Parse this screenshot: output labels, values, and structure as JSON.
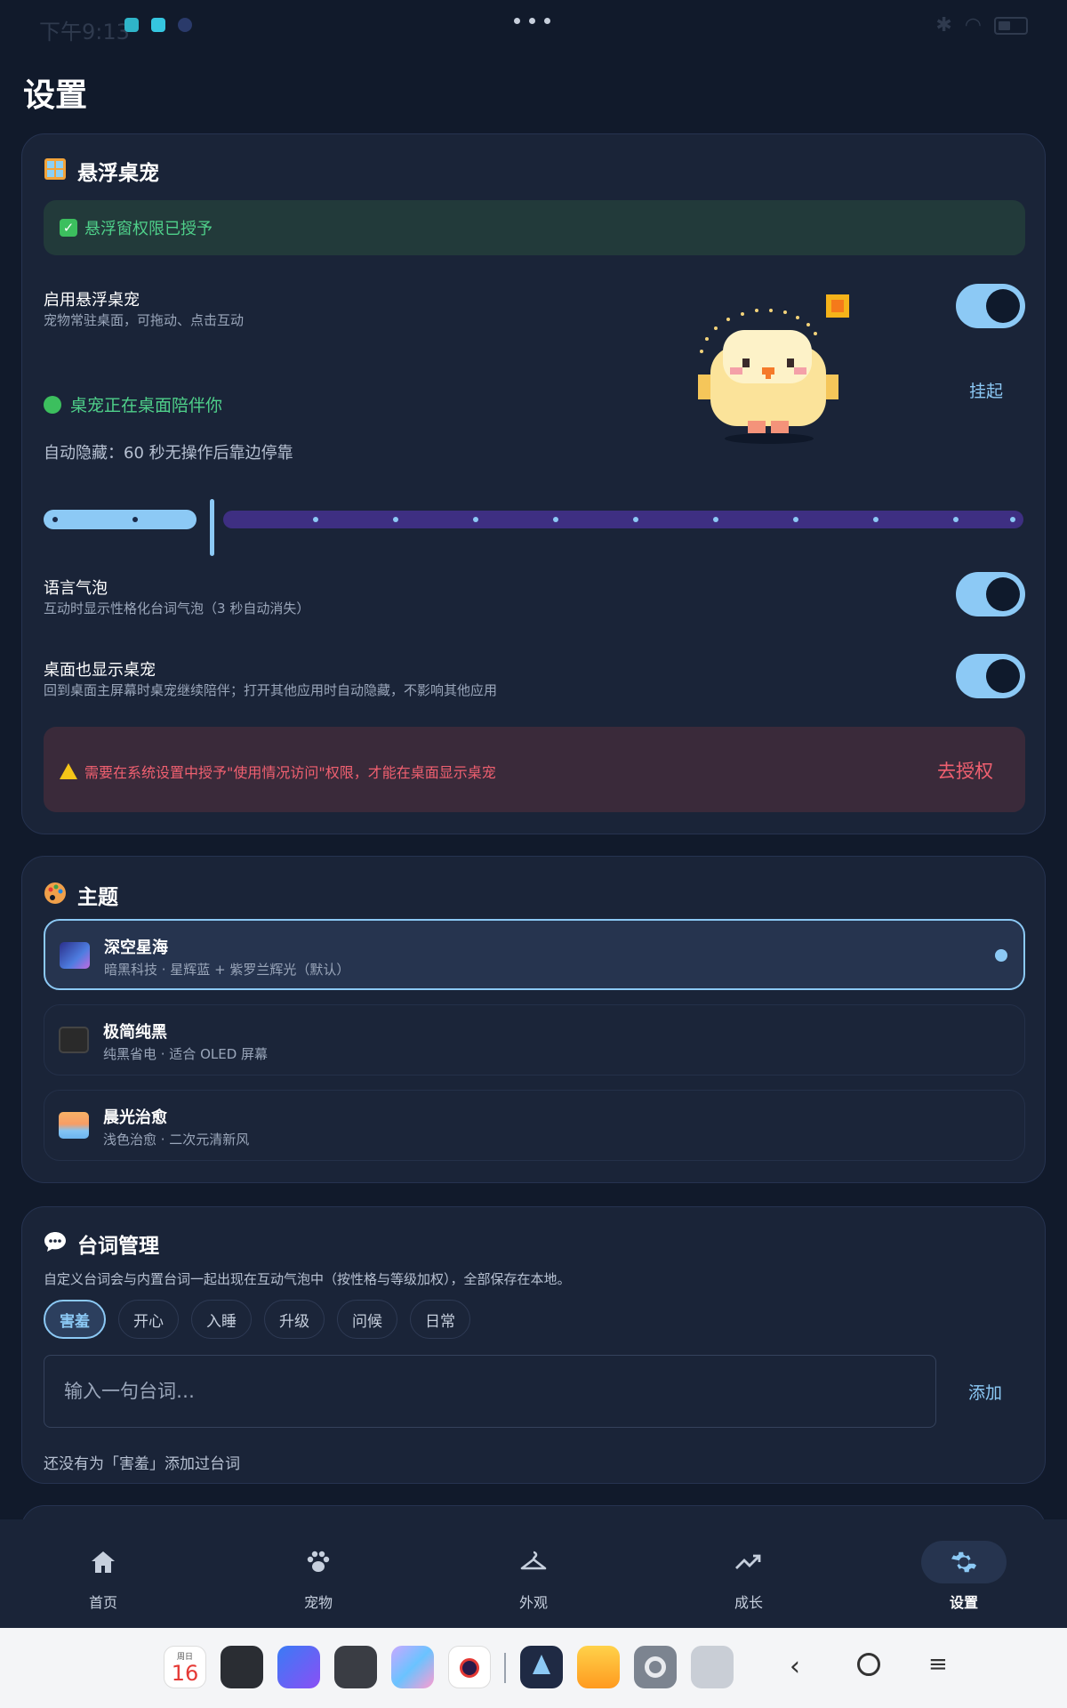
{
  "status_bar": {
    "time": "下午9:13",
    "dots": "•••"
  },
  "page": {
    "title": "设置"
  },
  "floating_pet": {
    "icon": "window-icon",
    "title": "悬浮桌宠",
    "permission_granted": "悬浮窗权限已授予",
    "enable": {
      "title": "启用悬浮桌宠",
      "subtitle": "宠物常驻桌面，可拖动、点击互动",
      "on": true
    },
    "status_text": "桌宠正在桌面陪伴你",
    "suspend_label": "挂起",
    "auto_hide_label": "自动隐藏：60 秒无操作后靠边停靠",
    "auto_hide_seconds": 60,
    "slider_fraction": 0.16,
    "speech_bubble": {
      "title": "语言气泡",
      "subtitle": "互动时显示性格化台词气泡（3 秒自动消失）",
      "on": true
    },
    "show_on_desktop": {
      "title": "桌面也显示桌宠",
      "subtitle": "回到桌面主屏幕时桌宠继续陪伴；打开其他应用时自动隐藏，不影响其他应用",
      "on": true
    },
    "warning_text": "需要在系统设置中授予\"使用情况访问\"权限，才能在桌面显示桌宠",
    "warning_button": "去授权"
  },
  "theme": {
    "icon": "palette-icon",
    "title": "主题",
    "items": [
      {
        "name": "深空星海",
        "desc": "暗黑科技 · 星辉蓝 + 紫罗兰辉光（默认）",
        "selected": true,
        "icon": "galaxy-icon"
      },
      {
        "name": "极简纯黑",
        "desc": "纯黑省电 · 适合 OLED 屏幕",
        "selected": false,
        "icon": "black-square-icon"
      },
      {
        "name": "晨光治愈",
        "desc": "浅色治愈 · 二次元清新风",
        "selected": false,
        "icon": "sunrise-icon"
      }
    ]
  },
  "lines": {
    "icon": "speech-bubble-icon",
    "title": "台词管理",
    "desc": "自定义台词会与内置台词一起出现在互动气泡中（按性格与等级加权），全部保存在本地。",
    "chips": [
      "害羞",
      "开心",
      "入睡",
      "升级",
      "问候",
      "日常"
    ],
    "active_chip": "害羞",
    "input_placeholder": "输入一句台词…",
    "add_label": "添加",
    "empty_text": "还没有为「害羞」添加过台词"
  },
  "bottom_nav": [
    {
      "label": "首页",
      "icon": "home-icon"
    },
    {
      "label": "宠物",
      "icon": "paw-icon"
    },
    {
      "label": "外观",
      "icon": "hanger-icon"
    },
    {
      "label": "成长",
      "icon": "trending-icon"
    },
    {
      "label": "设置",
      "icon": "gear-icon",
      "active": true
    }
  ],
  "dock": {
    "calendar_weekday": "周日",
    "calendar_day": "16"
  },
  "colors": {
    "background": "#111a2b",
    "card": "#1a2438",
    "accent": "#8cc9f5",
    "success": "#4fd08a",
    "danger": "#f06070",
    "slider_track": "#3e2f82"
  }
}
